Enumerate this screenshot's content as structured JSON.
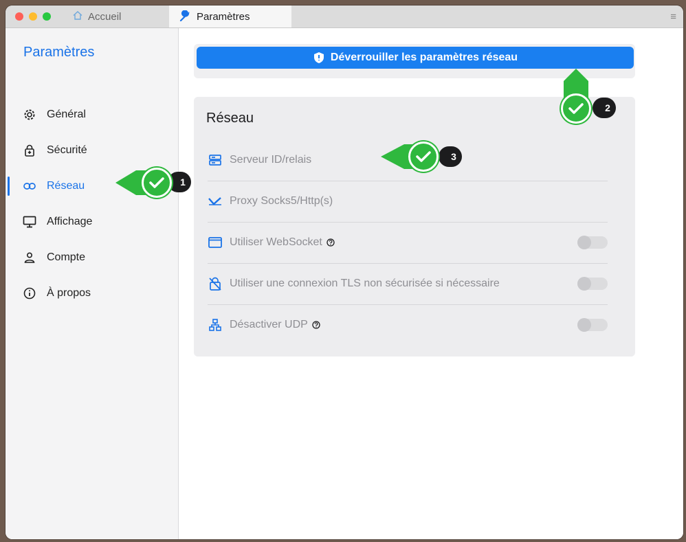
{
  "tabs": {
    "home_label": "Accueil",
    "params_label": "Paramètres"
  },
  "sidebar": {
    "title": "Paramètres",
    "items": [
      {
        "label": "Général",
        "icon": "gear-icon"
      },
      {
        "label": "Sécurité",
        "icon": "lock-icon"
      },
      {
        "label": "Réseau",
        "icon": "link-icon",
        "active": true
      },
      {
        "label": "Affichage",
        "icon": "monitor-icon"
      },
      {
        "label": "Compte",
        "icon": "person-icon"
      },
      {
        "label": "À propos",
        "icon": "info-icon"
      }
    ]
  },
  "main": {
    "unlock_label": "Déverrouiller les paramètres réseau",
    "card_title": "Réseau",
    "rows": [
      {
        "label": "Serveur ID/relais",
        "icon": "server-icon"
      },
      {
        "label": "Proxy Socks5/Http(s)",
        "icon": "proxy-icon"
      },
      {
        "label": "Utiliser WebSocket",
        "icon": "window-icon"
      },
      {
        "label": "Utiliser une connexion TLS non sécurisée si nécessaire",
        "icon": "lock-off-icon"
      },
      {
        "label": "Désactiver UDP",
        "icon": "network-icon"
      }
    ]
  },
  "callouts": {
    "one": "1",
    "two": "2",
    "three": "3"
  },
  "colors": {
    "accent": "#1a73e8",
    "button": "#1a7ff0",
    "callout_green": "#2fb83e"
  }
}
